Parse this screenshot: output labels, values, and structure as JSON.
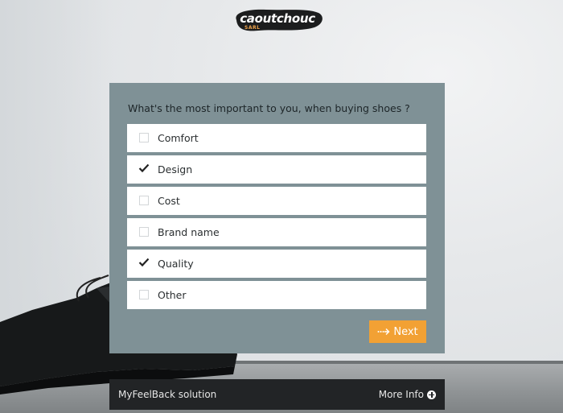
{
  "brand": {
    "name": "caoutchouc",
    "subtitle": "SARL"
  },
  "survey": {
    "question": "What's the most important to you, when buying shoes ?",
    "options": [
      {
        "label": "Comfort",
        "checked": false
      },
      {
        "label": "Design",
        "checked": true
      },
      {
        "label": "Cost",
        "checked": false
      },
      {
        "label": "Brand name",
        "checked": false
      },
      {
        "label": "Quality",
        "checked": true
      },
      {
        "label": "Other",
        "checked": false
      }
    ],
    "next_label": "Next"
  },
  "footer": {
    "left_text": "MyFeelBack solution",
    "more_info_label": "More Info"
  },
  "colors": {
    "panel": "#7f9196",
    "accent": "#f2a134",
    "footer": "#222426"
  }
}
